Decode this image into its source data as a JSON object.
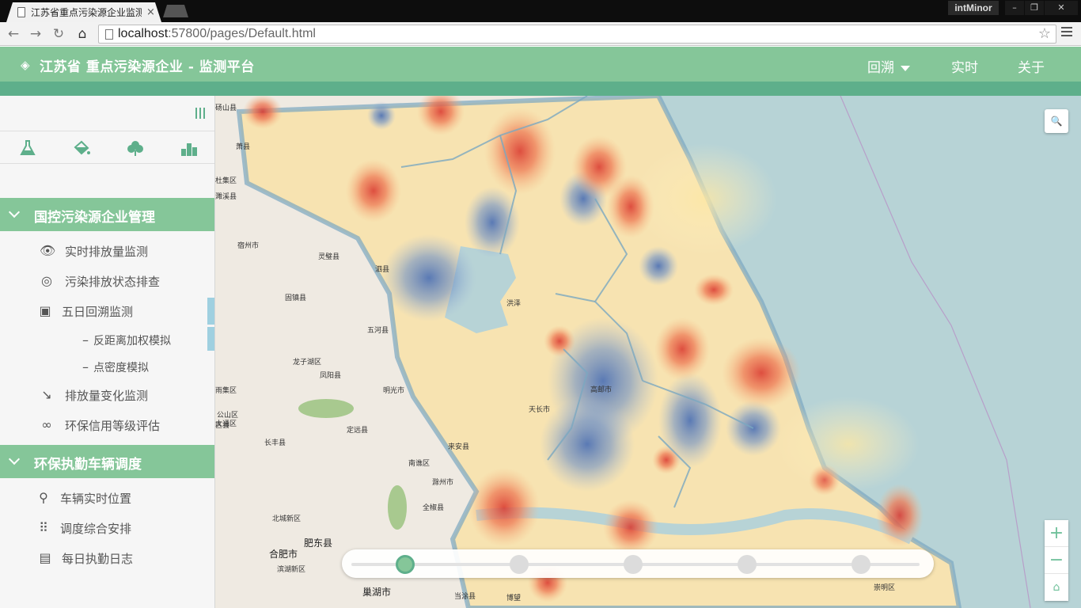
{
  "browser": {
    "tab_title": "江苏省重点污染源企业监测",
    "tab_close": "×",
    "user_badge": "intMinor",
    "url_host": "localhost",
    "url_rest": ":57800/pages/Default.html",
    "win_min": "–",
    "win_restore": "❐",
    "win_close": "✕"
  },
  "header": {
    "title": "江苏省 重点污染源企业 - 监测平台",
    "nav": [
      {
        "label": "回溯"
      },
      {
        "label": "实时"
      },
      {
        "label": "关于"
      }
    ]
  },
  "sidebar": {
    "sections": [
      {
        "title": "国控污染源企业管理",
        "items": [
          {
            "label": "实时排放量监测",
            "icon": "eye-icon"
          },
          {
            "label": "污染排放状态排查",
            "icon": "target-icon"
          },
          {
            "label": "五日回溯监测",
            "icon": "calendar-icon"
          },
          {
            "label": "反距离加权模拟",
            "icon": "dash-icon"
          },
          {
            "label": "点密度模拟",
            "icon": "dash-icon"
          },
          {
            "label": "排放量变化监测",
            "icon": "trend-down-icon"
          },
          {
            "label": "环保信用等级评估",
            "icon": "infinity-icon"
          }
        ]
      },
      {
        "title": "环保执勤车辆调度",
        "items": [
          {
            "label": "车辆实时位置",
            "icon": "map-pin-icon"
          },
          {
            "label": "调度综合安排",
            "icon": "grid-icon"
          },
          {
            "label": "每日执勤日志",
            "icon": "clipboard-icon"
          }
        ]
      }
    ]
  },
  "map": {
    "labels": [
      {
        "text": "萧县"
      },
      {
        "text": "宿州市"
      },
      {
        "text": "灵璧县"
      },
      {
        "text": "泗县"
      },
      {
        "text": "固镇县"
      },
      {
        "text": "五河县"
      },
      {
        "text": "龙子湖区"
      },
      {
        "text": "凤阳县"
      },
      {
        "text": "明光市"
      },
      {
        "text": "天长市"
      },
      {
        "text": "定远县"
      },
      {
        "text": "来安县"
      },
      {
        "text": "长丰县"
      },
      {
        "text": "南谯区"
      },
      {
        "text": "滁州市"
      },
      {
        "text": "全椒县"
      },
      {
        "text": "北城新区"
      },
      {
        "text": "肥东县"
      },
      {
        "text": "合肥市"
      },
      {
        "text": "滨湖新区"
      },
      {
        "text": "巢湖市"
      },
      {
        "text": "当涂县"
      },
      {
        "text": "博望"
      },
      {
        "text": "崇明区"
      },
      {
        "text": "洪泽"
      },
      {
        "text": "高邮市"
      },
      {
        "text": "大通区"
      },
      {
        "text": "杜集区"
      },
      {
        "text": "雨集区"
      },
      {
        "text": "濉溪县"
      },
      {
        "text": "公山区"
      },
      {
        "text": "区县"
      },
      {
        "text": "砀山县"
      }
    ],
    "slider_active_index": 0,
    "slider_stops": 5
  },
  "colors": {
    "accent": "#85c699",
    "accent_dark": "#5eaf8b",
    "water": "#b7d3d6"
  }
}
